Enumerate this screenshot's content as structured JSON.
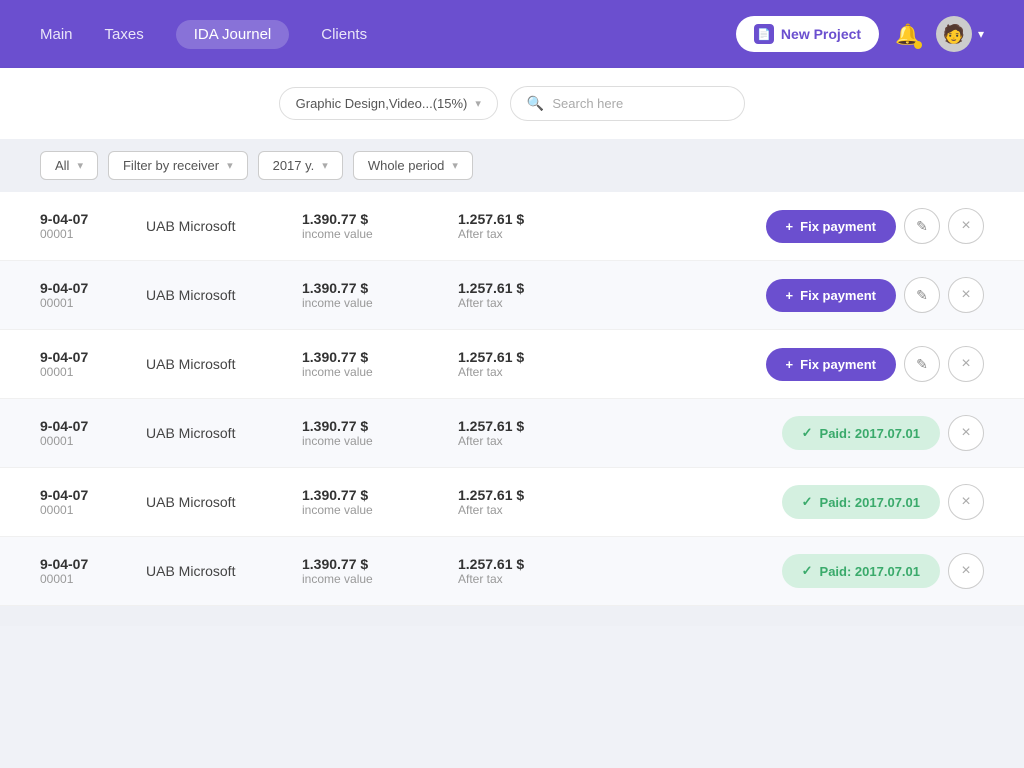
{
  "header": {
    "nav": [
      {
        "label": "Main",
        "active": false
      },
      {
        "label": "Taxes",
        "active": false
      },
      {
        "label": "IDA Journel",
        "active": true
      },
      {
        "label": "Clients",
        "active": false
      }
    ],
    "new_project_label": "New Project",
    "avatar_emoji": "🧑"
  },
  "filterbar": {
    "dropdown_label": "Graphic Design,Video...(15%)",
    "search_placeholder": "Search here"
  },
  "controls": {
    "all_label": "All",
    "filter_receiver_label": "Filter by receiver",
    "year_label": "2017 y.",
    "period_label": "Whole period"
  },
  "rows": [
    {
      "date": "9-04-07",
      "id": "00001",
      "client": "UAB Microsoft",
      "income": "1.390.77 $",
      "income_label": "income value",
      "after_tax": "1.257.61 $",
      "after_tax_label": "After tax",
      "status": "fix",
      "group_spacer": true
    },
    {
      "date": "9-04-07",
      "id": "00001",
      "client": "UAB Microsoft",
      "income": "1.390.77 $",
      "income_label": "income value",
      "after_tax": "1.257.61 $",
      "after_tax_label": "After tax",
      "status": "fix",
      "group_spacer": false
    },
    {
      "date": "9-04-07",
      "id": "00001",
      "client": "UAB Microsoft",
      "income": "1.390.77 $",
      "income_label": "income value",
      "after_tax": "1.257.61 $",
      "after_tax_label": "After tax",
      "status": "fix",
      "group_spacer": false
    },
    {
      "date": "9-04-07",
      "id": "00001",
      "client": "UAB Microsoft",
      "income": "1.390.77 $",
      "income_label": "income value",
      "after_tax": "1.257.61 $",
      "after_tax_label": "After tax",
      "status": "paid",
      "paid_date": "Paid: 2017.07.01",
      "group_spacer": false
    },
    {
      "date": "9-04-07",
      "id": "00001",
      "client": "UAB Microsoft",
      "income": "1.390.77 $",
      "income_label": "income value",
      "after_tax": "1.257.61 $",
      "after_tax_label": "After tax",
      "status": "paid",
      "paid_date": "Paid: 2017.07.01",
      "group_spacer": false
    },
    {
      "date": "9-04-07",
      "id": "00001",
      "client": "UAB Microsoft",
      "income": "1.390.77 $",
      "income_label": "income value",
      "after_tax": "1.257.61 $",
      "after_tax_label": "After tax",
      "status": "paid",
      "paid_date": "Paid: 2017.07.01",
      "group_spacer": false
    }
  ],
  "icons": {
    "fix_payment_plus": "+",
    "paid_check": "✓",
    "edit_pencil": "✎",
    "close_x": "×",
    "chevron_down": "▾",
    "search": "🔍",
    "bell": "🔔",
    "document": "📄"
  }
}
